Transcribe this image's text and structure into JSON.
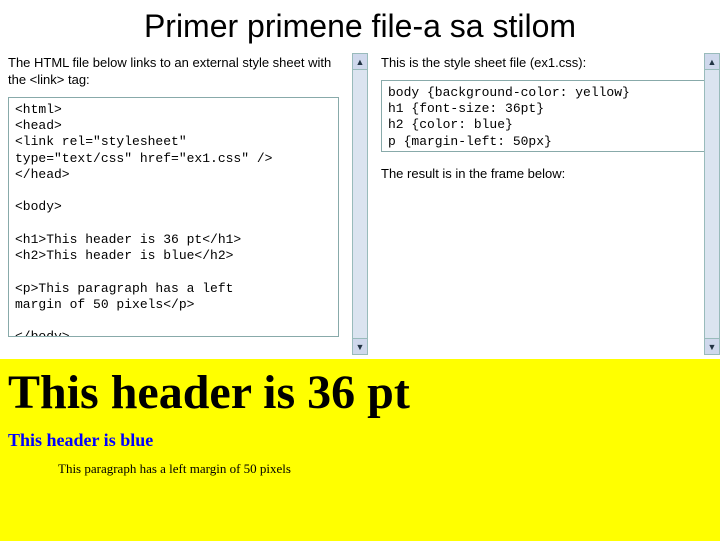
{
  "title": "Primer primene file-a sa stilom",
  "left": {
    "intro": "The HTML file below links to an external style sheet with the <link> tag:",
    "code": "<html>\n<head>\n<link rel=\"stylesheet\"\ntype=\"text/css\" href=\"ex1.css\" />\n</head>\n\n<body>\n\n<h1>This header is 36 pt</h1>\n<h2>This header is blue</h2>\n\n<p>This paragraph has a left\nmargin of 50 pixels</p>\n\n</body>\n</html>"
  },
  "right": {
    "intro": "This is the style sheet file (ex1.css):",
    "code": "body {background-color: yellow}\nh1 {font-size: 36pt}\nh2 {color: blue}\np {margin-left: 50px}",
    "result_intro": "The result is in the frame below:"
  },
  "rendered": {
    "h1": "This header is 36 pt",
    "h2": "This header is blue",
    "p": "This paragraph has a left margin of 50 pixels"
  },
  "scroll": {
    "up": "▲",
    "down": "▼"
  }
}
